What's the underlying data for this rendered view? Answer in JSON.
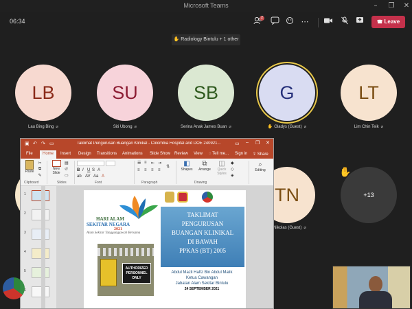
{
  "window": {
    "title": "Microsoft Teams"
  },
  "meeting": {
    "timer": "06:34",
    "participants_badge": "2",
    "leave_label": "Leave",
    "raised_hand_banner": "Radiology Bintulu + 1 other"
  },
  "participants": [
    {
      "initials": "LB",
      "name": "Lau Bing Bing",
      "color": "#f7d9d0",
      "text_color": "#8a2a18"
    },
    {
      "initials": "SU",
      "name": "Siti Ubong",
      "color": "#f7d3da",
      "text_color": "#8c1c33"
    },
    {
      "initials": "SB",
      "name": "Serina Anak James Buan",
      "color": "#dbe8d2",
      "text_color": "#2f5a1e"
    },
    {
      "initials": "G",
      "name": "Gladys (Guest)",
      "color": "#d9dcf2",
      "text_color": "#26307a",
      "hand_raised": true
    },
    {
      "initials": "LT",
      "name": "Lim Chin Teik",
      "color": "#f7e3cf",
      "text_color": "#7a4d12"
    }
  ],
  "second_row": {
    "partial_initials": "TN",
    "partial_name": "as Nikolas (Guest)",
    "more_count": "+13"
  },
  "powerpoint": {
    "doc_title": "Taklimat Pengurusan Buangan Klinikal - Colombia Hospital and DOE 240921...",
    "tabs": [
      "File",
      "Home",
      "Insert",
      "Design",
      "Transitions",
      "Animations",
      "Slide Show",
      "Review",
      "View",
      "Tell me...",
      "Sign in",
      "Share"
    ],
    "ribbon": {
      "paste": "Paste",
      "new_slide": "New Slide",
      "shapes": "Shapes",
      "arrange": "Arrange",
      "quick_styles": "Quick Styles",
      "editing": "Editing",
      "groups": [
        "Clipboard",
        "Slides",
        "Font",
        "Paragraph",
        "Drawing"
      ]
    },
    "thumbnails": [
      "1",
      "2",
      "3",
      "4",
      "5",
      "6"
    ],
    "slide": {
      "banner_top": "HARI ALAM",
      "banner_mid": "SEKITAR NEGARA",
      "banner_year": "2021",
      "tagline": "Alam Sekitar Tanggungjawab Bersama",
      "sign": "AUTHORIZED PERSONNEL ONLY",
      "title_lines": [
        "TAKLIMAT",
        "PENGURUSAN",
        "BUANGAN KLINIKAL",
        "DI BAWAH",
        "PPKAS (BT) 2005"
      ],
      "presenter": "Abdul Mazli Hafiz Bin Abdul Malik",
      "role": "Ketua Cawangan",
      "dept": "Jabatan Alam Sekitar Bintulu",
      "date": "24 SEPTEMBER 2021"
    }
  }
}
